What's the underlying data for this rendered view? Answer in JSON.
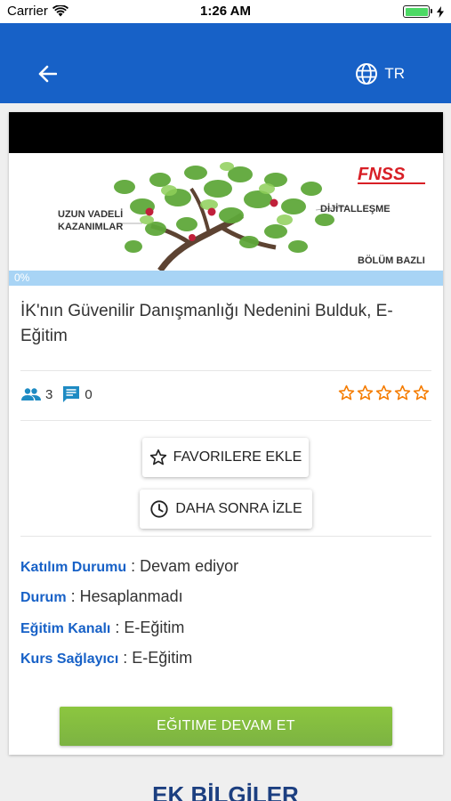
{
  "status_bar": {
    "carrier": "Carrier",
    "time": "1:26 AM"
  },
  "header": {
    "language": "TR"
  },
  "course": {
    "progress": "0%",
    "title": "İK'nın Güvenilir Danışmanlığı Nedenini Bulduk, E-Eğitim",
    "participants": "3",
    "comments": "0",
    "rating": 0,
    "rating_max": 5
  },
  "banner": {
    "brand": "FNSS",
    "left_text_1": "UZUN VADELİ",
    "left_text_2": "KAZANIMLAR",
    "right_text_1": "DİJİTALLEŞME",
    "right_text_2": "BÖLÜM BAZLI"
  },
  "actions": {
    "favorite_label": "FAVORILERE EKLE",
    "watch_later_label": "DAHA SONRA İZLE",
    "continue_label": "EĞITIME DEVAM ET"
  },
  "info": [
    {
      "key": "Katılım Durumu",
      "value": " : Devam ediyor"
    },
    {
      "key": "Durum",
      "value": " : Hesaplanmadı"
    },
    {
      "key": "Eğitim Kanalı",
      "value": " : E-Eğitim"
    },
    {
      "key": "Kurs Sağlayıcı",
      "value": " : E-Eğitim"
    }
  ],
  "section": {
    "title": "EK BİLGİLER"
  },
  "colors": {
    "primary": "#1761c7",
    "accent": "#f57c00",
    "success": "#8bc34a"
  }
}
